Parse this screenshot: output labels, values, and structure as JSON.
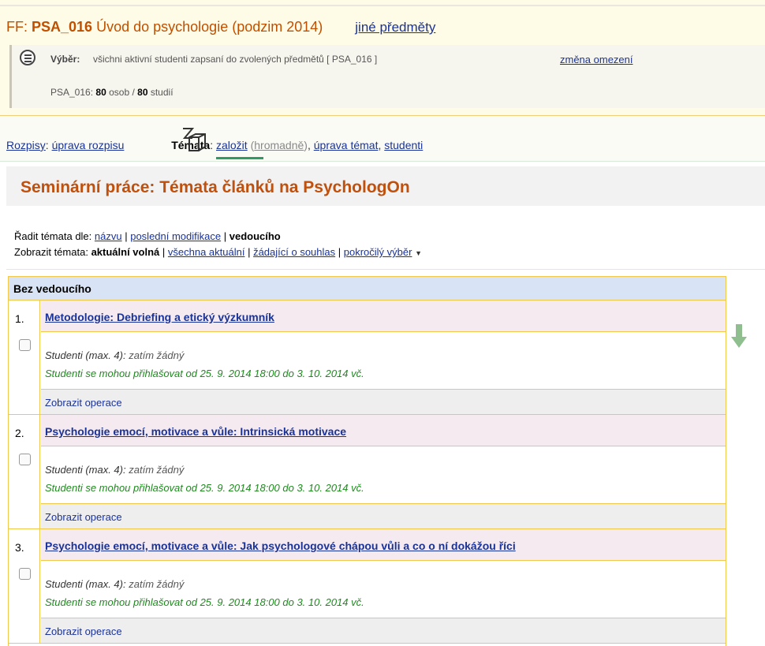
{
  "header": {
    "faculty": "FF:",
    "course_code": "PSA_016",
    "course_name": "Úvod do psychologie (podzim 2014)",
    "other_subjects_link": "jiné předměty"
  },
  "filter": {
    "label": "Výběr:",
    "text": "všichni aktivní studenti zapsaní do zvolených předmětů [ PSA_016 ]",
    "change_link": "změna omezení",
    "count_prefix": "PSA_016:",
    "count_persons": "80",
    "count_persons_unit": "osob /",
    "count_studies": "80",
    "count_studies_unit": "studií"
  },
  "nav": {
    "rozpisy": "Rozpisy",
    "uprava_rozpisu": "úprava rozpisu",
    "temata": "Témata",
    "zalozit": "založit",
    "hromadne": "hromadně",
    "uprava_temat": "úprava témat",
    "studenti": "studenti"
  },
  "page_title": "Seminární práce: Témata článků na PsychologOn",
  "sort": {
    "label": "Řadit témata dle:",
    "by_name": "názvu",
    "by_modified": "poslední modifikace",
    "by_supervisor": "vedoucího"
  },
  "show": {
    "label": "Zobrazit témata:",
    "current_free": "aktuální volná",
    "all_current": "všechna aktuální",
    "requesting": "žádající o souhlas",
    "advanced": "pokročilý výběr"
  },
  "group": {
    "label": "Bez vedoucího"
  },
  "topics": [
    {
      "number": "1.",
      "title": "Metodologie: Debriefing a etický výzkumník",
      "students_label": "Studenti (max. 4):",
      "students_value": "zatím žádný",
      "signup": "Studenti se mohou přihlašovat od 25. 9. 2014 18:00 do 3. 10. 2014 vč.",
      "ops": "Zobrazit operace"
    },
    {
      "number": "2.",
      "title": "Psychologie emocí, motivace a vůle: Intrinsická motivace",
      "students_label": "Studenti (max. 4):",
      "students_value": "zatím žádný",
      "signup": "Studenti se mohou přihlašovat od 25. 9. 2014 18:00 do 3. 10. 2014 vč.",
      "ops": "Zobrazit operace"
    },
    {
      "number": "3.",
      "title": "Psychologie emocí, motivace a vůle: Jak psychologové chápou vůli a co o ní dokážou říci",
      "students_label": "Studenti (max. 4):",
      "students_value": "zatím žádný",
      "signup": "Studenti se mohou přihlašovat od 25. 9. 2014 18:00 do 3. 10. 2014 vč.",
      "ops": "Zobrazit operace"
    }
  ],
  "icons": {
    "filter": "list-icon",
    "topics": "topics-icon",
    "scroll": "arrow-down-icon",
    "dropdown": "caret-down-icon"
  },
  "colors": {
    "title_orange": "#c0500d",
    "link_blue": "#1a3399",
    "signup_green": "#1e8a1e",
    "arrow_green": "#8fbf8f",
    "active_tab_green": "#2e9b63",
    "border_yellow": "#f2c84b",
    "group_head_blue": "#d8e4f5",
    "topic_title_pink": "#f5eaf0"
  }
}
